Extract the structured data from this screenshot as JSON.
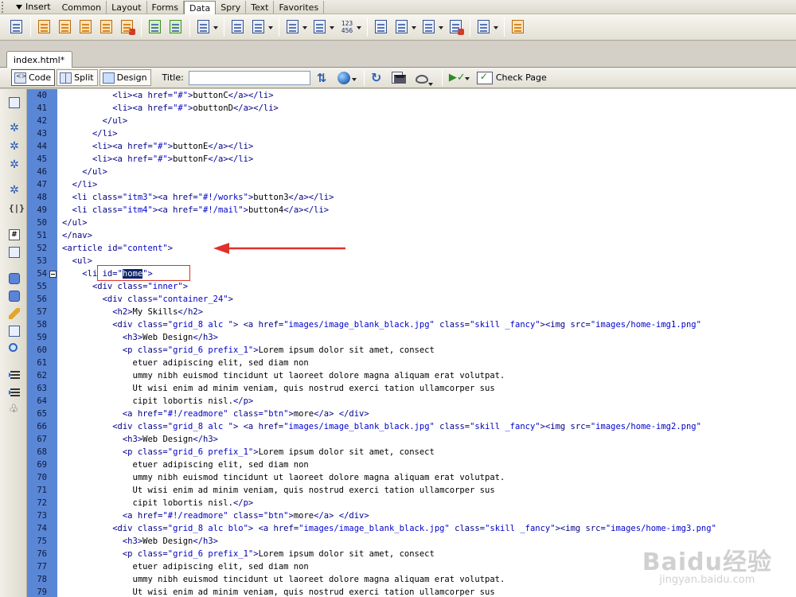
{
  "insert_bar": {
    "label": "Insert",
    "tabs": [
      "Common",
      "Layout",
      "Forms",
      "Data",
      "Spry",
      "Text",
      "Favorites"
    ],
    "active_tab": "Data"
  },
  "document": {
    "tab_name": "index.html*",
    "views": [
      "Code",
      "Split",
      "Design"
    ],
    "title_label": "Title:",
    "title_value": "",
    "check_page_label": "Check Page"
  },
  "gutter": {
    "line_numbers": [
      "40",
      "41",
      "42",
      "43",
      "44",
      "45",
      "46",
      "47",
      "48",
      "49",
      "50",
      "51",
      "52",
      "53",
      "54",
      "55",
      "56",
      "57",
      "58",
      "59",
      "60",
      "61",
      "62",
      "63",
      "64",
      "65",
      "66",
      "67",
      "68",
      "69",
      "70",
      "71",
      "72",
      "73",
      "74",
      "75",
      "76",
      "77",
      "78",
      "79"
    ]
  },
  "code": {
    "lines": [
      "          <li><a href=\"#\">buttonC</a></li>",
      "          <li><a href=\"#\">obuttonD</a></li>",
      "        </ul>",
      "      </li>",
      "      <li><a href=\"#\">buttonE</a></li>",
      "      <li><a href=\"#\">buttonF</a></li>",
      "    </ul>",
      "  </li>",
      "  <li class=\"itm3\"><a href=\"#!/works\">button3</a></li>",
      "  <li class=\"itm4\"><a href=\"#!/mail\">button4</a></li>",
      "</ul>",
      "</nav>",
      "<article id=\"content\">",
      "  <ul>",
      "    <li id=\"home\">",
      "      <div class=\"inner\">",
      "        <div class=\"container_24\">",
      "          <h2>My Skills</h2>",
      "          <div class=\"grid_8 alc \"> <a href=\"images/image_blank_black.jpg\" class=\"skill _fancy\"><img src=\"images/home-img1.png\"",
      "            <h3>Web Design</h3>",
      "            <p class=\"grid_6 prefix_1\">Lorem ipsum dolor sit amet, consect",
      "              etuer adipiscing elit, sed diam non",
      "              ummy nibh euismod tincidunt ut laoreet dolore magna aliquam erat volutpat.",
      "              Ut wisi enim ad minim veniam, quis nostrud exerci tation ullamcorper sus",
      "              cipit lobortis nisl.</p>",
      "            <a href=\"#!/readmore\" class=\"btn\">more</a> </div>",
      "          <div class=\"grid_8 alc \"> <a href=\"images/image_blank_black.jpg\" class=\"skill _fancy\"><img src=\"images/home-img2.png\"",
      "            <h3>Web Design</h3>",
      "            <p class=\"grid_6 prefix_1\">Lorem ipsum dolor sit amet, consect",
      "              etuer adipiscing elit, sed diam non",
      "              ummy nibh euismod tincidunt ut laoreet dolore magna aliquam erat volutpat.",
      "              Ut wisi enim ad minim veniam, quis nostrud exerci tation ullamcorper sus",
      "              cipit lobortis nisl.</p>",
      "            <a href=\"#!/readmore\" class=\"btn\">more</a> </div>",
      "          <div class=\"grid_8 alc blo\"> <a href=\"images/image_blank_black.jpg\" class=\"skill _fancy\"><img src=\"images/home-img3.png\"",
      "            <h3>Web Design</h3>",
      "            <p class=\"grid_6 prefix_1\">Lorem ipsum dolor sit amet, consect",
      "              etuer adipiscing elit, sed diam non",
      "              ummy nibh euismod tincidunt ut laoreet dolore magna aliquam erat volutpat.",
      "              Ut wisi enim ad minim veniam, quis nostrud exerci tation ullamcorper sus"
    ],
    "selected_text": "home",
    "selected_line_index": 14
  },
  "colors": {
    "annotation": "#e0312a",
    "gutter": "#5a86d6",
    "selection": "#0a246a"
  },
  "watermark": {
    "logo": "Baidu经验",
    "url": "jingyan.baidu.com"
  }
}
